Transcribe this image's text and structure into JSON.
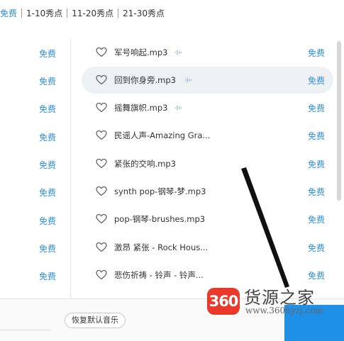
{
  "tabs": [
    "免费",
    "1-10秀点",
    "11-20秀点",
    "21-30秀点"
  ],
  "free_label": "免费",
  "songs": [
    {
      "name": "军号响起.mp3"
    },
    {
      "name": "回到你身旁.mp3"
    },
    {
      "name": "摇舞旗帜.mp3"
    },
    {
      "name": "民谣人声-Amazing Gra..."
    },
    {
      "name": "紧张的交响.mp3"
    },
    {
      "name": "synth pop-钢琴-梦.mp3"
    },
    {
      "name": "pop-钢琴-brushes.mp3"
    },
    {
      "name": "激昂 紧张 - Rock Hous..."
    },
    {
      "name": "悲伤祈祷 - 铃声 - 铃声..."
    }
  ],
  "bottom": {
    "restore_label": "恢复默认音乐"
  },
  "watermark": {
    "badge": "360",
    "name": "货源之家",
    "url": "www.360hyzj.com"
  },
  "colors": {
    "accent": "#2f8fd8",
    "button_blue": "#1e90e8",
    "highlight_row": "#eef1f4",
    "logo_red": "#e8392a"
  }
}
